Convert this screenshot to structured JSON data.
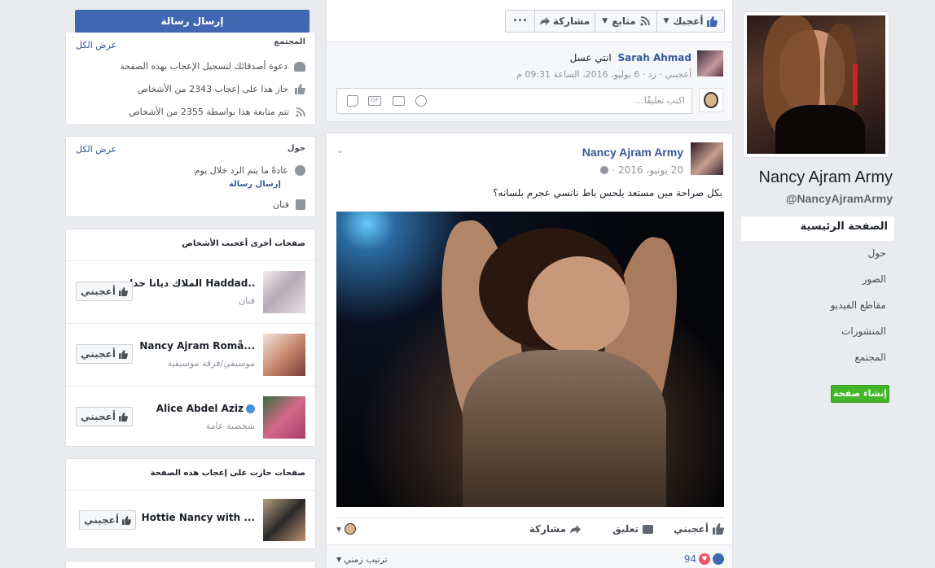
{
  "page": {
    "name": "Nancy Ajram Army",
    "handle": "@NancyAjramArmy",
    "nav": [
      "الصفحة الرئيسية",
      "حول",
      "الصور",
      "مقاطع الفيديو",
      "المنشورات",
      "المجتمع"
    ],
    "create_page": "إنشاء صفحة"
  },
  "actions": {
    "like": "أعجبك",
    "follow": "متابع",
    "share": "مشاركة",
    "more": "•••",
    "send_message": "إرسال رسالة"
  },
  "community": {
    "title": "المجتمع",
    "see_all": "عرض الكل",
    "invite": "دعوة أصدقائك لتسجيل الإعجاب بهذه الصفحة",
    "invite_link": "دعوة أصدقائك",
    "likes": "حاز هذا على إعجاب 2343 من الأشخاص",
    "follows": "تتم متابعة هذا بواسطة 2355 من الأشخاص"
  },
  "about": {
    "title": "حول",
    "see_all": "عرض الكل",
    "response": "عادةً ما يتم الرد خلال يوم",
    "send_message": "إرسال رسالة",
    "category": "فنان"
  },
  "liked_pages": {
    "title": "صفحات أخرى أعجبت الأشخاص",
    "like_button": "أعجبني",
    "items": [
      {
        "name": "الملاك ديانا حداد Haddad...",
        "category": "فنان"
      },
      {
        "name": "Nancy Ajram Romå...",
        "category": "موسيقي/فرقة موسيقية"
      },
      {
        "name": "Alice Abdel Aziz",
        "category": "شخصية عامة"
      }
    ]
  },
  "liked_this_page": {
    "title": "صفحات حازت على إعجاب هذه الصفحة",
    "like_button": "أعجبني",
    "items": [
      {
        "name": "Hottie Nancy with ..."
      }
    ]
  },
  "comment": {
    "author": "Sarah Ahmad",
    "text": "انتي عسل",
    "meta": "أعجبني · رد · 6 يوليو، 2016، الساعة 09:31 م",
    "write_placeholder": "اكتب تعليقًا..."
  },
  "post": {
    "author": "Nancy Ajram Army",
    "date": "20 يونيو، 2016",
    "text": "بكل صراحة مين مستعد يلحس باط نانسي عجرم بلسانه؟",
    "like": "أعجبني",
    "comment": "تعليق",
    "share": "مشاركة",
    "reactions_count": "94",
    "sort": "ترتيب زمني"
  },
  "colors": {
    "brand": "#4267b2",
    "link": "#365899",
    "green": "#42b72a",
    "love": "#f25268"
  }
}
